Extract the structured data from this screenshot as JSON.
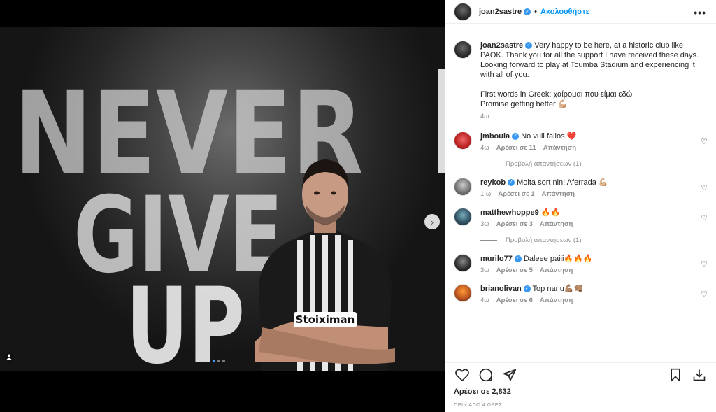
{
  "media": {
    "poster_words": [
      "NEVER",
      "GIVE",
      "UP"
    ],
    "jersey_text": "Stoiximan",
    "carousel": {
      "count": 3,
      "active": 0
    }
  },
  "header": {
    "username": "joan2sastre",
    "separator": "•",
    "follow_label": "Ακολουθήστε",
    "more_label": "•••"
  },
  "caption": {
    "username": "joan2sastre",
    "text": "Very happy to be here, at a historic club like PAOK. Thank you for all the support I have received these days. Looking forward to play at Toumba Stadium and experiencing it with all of you.",
    "line2": "First words in Greek: χαίρομαι που είμαι εδώ",
    "line3": "Promise getting better 💪🏼",
    "time": "4ω"
  },
  "comments": [
    {
      "username": "jmboula",
      "text": "No vull fallos.❤️",
      "time": "4ω",
      "likes": "Αρέσει σε 11",
      "reply": "Απάντηση",
      "replies": "Προβολή απαντήσεων (1)"
    },
    {
      "username": "reykob",
      "text": "Molta sort nin! Aferrada 💪🏼",
      "time": "1 ω",
      "likes": "Αρέσει σε 1",
      "reply": "Απάντηση",
      "replies": ""
    },
    {
      "username": "matthewhoppe9",
      "text": "🔥🔥",
      "time": "3ω",
      "likes": "Αρέσει σε 3",
      "reply": "Απάντηση",
      "replies": "Προβολή απαντήσεων (1)"
    },
    {
      "username": "murilo77",
      "text": "Daleee paiii🔥🔥🔥",
      "time": "3ω",
      "likes": "Αρέσει σε 5",
      "reply": "Απάντηση",
      "replies": ""
    },
    {
      "username": "brianolivan",
      "text": "Top nanu💪🏽👊🏽",
      "time": "4ω",
      "likes": "Αρέσει σε 6",
      "reply": "Απάντηση",
      "replies": ""
    }
  ],
  "footer": {
    "likes": "Αρέσει σε 2,832",
    "posted": "ΠΡΙΝ ΑΠΟ 4 ΩΡΕΣ"
  },
  "colors": {
    "accent": "#0095f6",
    "verified": "#3897f0",
    "muted": "#8e8e8e"
  }
}
